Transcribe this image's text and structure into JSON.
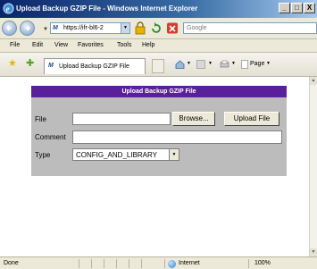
{
  "window": {
    "title": "Upload Backup GZIP File - Windows Internet Explorer",
    "minimize_label": "_",
    "maximize_label": "□",
    "close_label": "X"
  },
  "address_bar": {
    "url": "https://ifr-bl6-2",
    "search_placeholder": "Google"
  },
  "menu": {
    "items": [
      "File",
      "Edit",
      "View",
      "Favorites",
      "Tools",
      "Help"
    ]
  },
  "tab": {
    "label": "Upload Backup GZIP File"
  },
  "command_bar": {
    "page_label": "Page"
  },
  "upload_form": {
    "header": "Upload Backup GZIP File",
    "file_label": "File",
    "browse_label": "Browse...",
    "upload_label": "Upload File",
    "comment_label": "Comment",
    "type_label": "Type",
    "type_value": "CONFIG_AND_LIBRARY",
    "header_color": "#5a1f9a",
    "panel_color": "#bcbcbc"
  },
  "status_bar": {
    "status": "Done",
    "zone": "Internet",
    "zoom": "100%"
  },
  "icons": {
    "back": "back-arrow-icon",
    "forward": "forward-arrow-icon",
    "lock": "lock-icon",
    "refresh": "refresh-icon",
    "stop": "stop-icon",
    "favorites": "star-icon",
    "add_favorites": "add-favorites-icon",
    "home": "home-icon",
    "feeds": "feeds-icon",
    "print": "print-icon",
    "globe": "internet-zone-icon"
  }
}
